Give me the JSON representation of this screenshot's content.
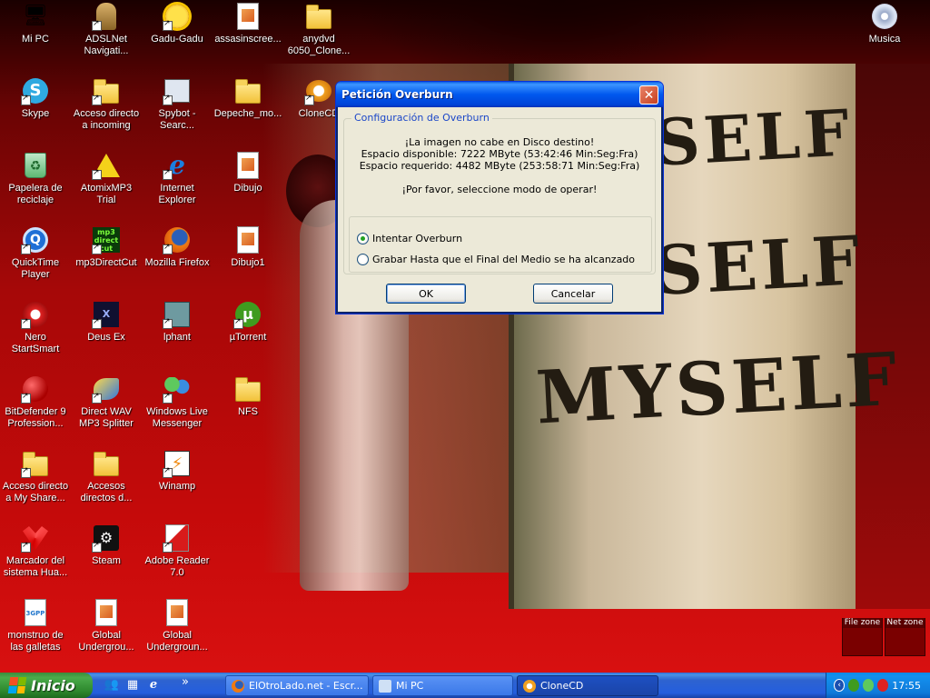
{
  "desktop": {
    "wallpaper_text": [
      "SELF",
      "SELF",
      "MYSELF"
    ],
    "icons": [
      {
        "label": "Mi PC",
        "icon": "computer-icon"
      },
      {
        "label": "ADSLNet Navigati...",
        "icon": "adslnet-icon"
      },
      {
        "label": "Gadu-Gadu",
        "icon": "gadu-gadu-icon"
      },
      {
        "label": "assasinscree...",
        "icon": "image-file-icon"
      },
      {
        "label": "anydvd 6050_Clone...",
        "icon": "folder-icon"
      },
      {
        "label": "Musica",
        "icon": "music-cd-icon"
      },
      {
        "label": "Skype",
        "icon": "skype-icon"
      },
      {
        "label": "Acceso directo a incoming",
        "icon": "folder-icon"
      },
      {
        "label": "Spybot - Searc...",
        "icon": "spybot-icon"
      },
      {
        "label": "Depeche_mo...",
        "icon": "folder-icon"
      },
      {
        "label": "CloneCD",
        "icon": "clonecd-icon"
      },
      {
        "label": "Papelera de reciclaje",
        "icon": "recycle-bin-icon"
      },
      {
        "label": "AtomixMP3 Trial",
        "icon": "atomix-icon"
      },
      {
        "label": "Internet Explorer",
        "icon": "ie-icon"
      },
      {
        "label": "Dibujo",
        "icon": "image-file-icon"
      },
      {
        "label": "QuickTime Player",
        "icon": "quicktime-icon"
      },
      {
        "label": "mp3DirectCut",
        "icon": "mp3directcut-icon"
      },
      {
        "label": "Mozilla Firefox",
        "icon": "firefox-icon"
      },
      {
        "label": "Dibujo1",
        "icon": "image-file-icon"
      },
      {
        "label": "Nero StartSmart",
        "icon": "nero-icon"
      },
      {
        "label": "Deus Ex",
        "icon": "deus-ex-icon"
      },
      {
        "label": "lphant",
        "icon": "lphant-icon"
      },
      {
        "label": "µTorrent",
        "icon": "utorrent-icon"
      },
      {
        "label": "BitDefender 9 Profession...",
        "icon": "bitdefender-icon"
      },
      {
        "label": "Direct WAV MP3 Splitter",
        "icon": "wav-splitter-icon"
      },
      {
        "label": "Windows Live Messenger",
        "icon": "messenger-icon"
      },
      {
        "label": "NFS",
        "icon": "folder-icon"
      },
      {
        "label": "Acceso directo a My Share...",
        "icon": "folder-icon"
      },
      {
        "label": "Accesos directos d...",
        "icon": "folder-icon"
      },
      {
        "label": "Winamp",
        "icon": "winamp-icon"
      },
      {
        "label": "Marcador del sistema Hua...",
        "icon": "huawei-icon"
      },
      {
        "label": "Steam",
        "icon": "steam-icon"
      },
      {
        "label": "Adobe Reader 7.0",
        "icon": "adobe-reader-icon"
      },
      {
        "label": "monstruo de las galletas",
        "icon": "3gp-file-icon"
      },
      {
        "label": "Global Undergrou...",
        "icon": "document-icon"
      },
      {
        "label": "Global Undergroun...",
        "icon": "document-icon"
      }
    ]
  },
  "dialog": {
    "title": "Petición Overburn",
    "group_title": "Configuración de Overburn",
    "message_line1": "¡La imagen no cabe en Disco destino!",
    "message_line2": "Espacio disponible: 7222 MByte (53:42:46 Min:Seg:Fra)",
    "message_line3": "Espacio requerido: 4482 MByte (253:58:71 Min:Seg:Fra)",
    "message_line4": "¡Por favor, seleccione modo de operar!",
    "options": [
      {
        "label": "Intentar Overburn",
        "selected": true
      },
      {
        "label": "Grabar Hasta que el Final del Medio se ha alcanzado",
        "selected": false
      }
    ],
    "ok_label": "OK",
    "cancel_label": "Cancelar",
    "close_symbol": "✕"
  },
  "monitor": {
    "file_zone": "File zone",
    "net_zone": "Net zone"
  },
  "taskbar": {
    "start_label": "Inicio",
    "overflow": "»",
    "tasks": [
      {
        "label": "ElOtroLado.net - Escr...",
        "icon": "firefox-icon",
        "active": false
      },
      {
        "label": "Mi PC",
        "icon": "computer-icon",
        "active": false
      },
      {
        "label": "CloneCD",
        "icon": "clonecd-icon",
        "active": true
      }
    ],
    "clock": "17:55"
  },
  "colors": {
    "titlebar": "#0058ee",
    "dialog_bg": "#ece9d8",
    "group_title": "#1a46c8",
    "start_green": "#3c8b3c",
    "taskbar_blue": "#245ede"
  }
}
